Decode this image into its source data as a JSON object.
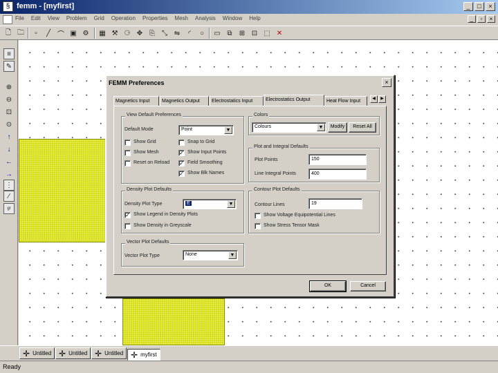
{
  "window": {
    "title": "femm - [myfirst]",
    "icon_glyph": "§"
  },
  "menu": [
    "File",
    "Edit",
    "View",
    "Problem",
    "Grid",
    "Operation",
    "Properties",
    "Mesh",
    "Analysis",
    "Window",
    "Help"
  ],
  "toolbar_icons": [
    {
      "name": "new-file-icon",
      "glyph": "🗋"
    },
    {
      "name": "open-folder-icon",
      "glyph": "🗀"
    },
    {
      "name": "node-mode-icon",
      "glyph": "▫"
    },
    {
      "name": "segment-mode-icon",
      "glyph": "╱"
    },
    {
      "name": "arc-mode-icon",
      "glyph": "⌒"
    },
    {
      "name": "block-label-mode-icon",
      "glyph": "▣"
    },
    {
      "name": "group-mode-icon",
      "glyph": "⚙"
    },
    {
      "name": "mesh-icon",
      "glyph": "▦"
    },
    {
      "name": "run-analysis-icon",
      "glyph": "⚒"
    },
    {
      "name": "view-results-icon",
      "glyph": "⚆"
    },
    {
      "name": "move-icon",
      "glyph": "✥"
    },
    {
      "name": "copy-icon",
      "glyph": "⎘"
    },
    {
      "name": "scale-icon",
      "glyph": "⤡"
    },
    {
      "name": "mirror-icon",
      "glyph": "⇋"
    },
    {
      "name": "fillet-icon",
      "glyph": "◜"
    },
    {
      "name": "circle-icon",
      "glyph": "○"
    },
    {
      "name": "window-icon",
      "glyph": "▭"
    },
    {
      "name": "cascade-icon",
      "glyph": "⧉"
    },
    {
      "name": "tile-icon",
      "glyph": "⊞"
    },
    {
      "name": "snap-icon",
      "glyph": "⊡"
    },
    {
      "name": "select-icon",
      "glyph": "⬚"
    },
    {
      "name": "delete-icon",
      "glyph": "✕"
    }
  ],
  "left_toolbar_icons": [
    {
      "name": "show-mesh-icon",
      "glyph": "≡"
    },
    {
      "name": "edit-icon",
      "glyph": "✎"
    },
    {
      "name": "zoom-in-icon",
      "glyph": "⊕"
    },
    {
      "name": "zoom-out-icon",
      "glyph": "⊖"
    },
    {
      "name": "zoom-window-icon",
      "glyph": "⊡"
    },
    {
      "name": "zoom-natural-icon",
      "glyph": "⊙"
    },
    {
      "name": "pan-up-icon",
      "glyph": "↑"
    },
    {
      "name": "pan-down-icon",
      "glyph": "↓"
    },
    {
      "name": "pan-left-icon",
      "glyph": "←"
    },
    {
      "name": "pan-right-icon",
      "glyph": "→"
    },
    {
      "name": "grid-toggle-icon",
      "glyph": "⋮"
    },
    {
      "name": "snap-grid-icon",
      "glyph": "⁄"
    },
    {
      "name": "grid-size-icon",
      "glyph": "gr"
    }
  ],
  "doc_tabs": [
    "Untitled",
    "Untitled",
    "Untitled",
    "myfirst"
  ],
  "status": "Ready",
  "dialog": {
    "title": "FEMM Preferences",
    "close": "×",
    "tabs": [
      "Magnetics Input",
      "Magnetics Output",
      "Electrostatics Input",
      "Electrostatics Output",
      "Heat Flow Input"
    ],
    "view_defaults": {
      "title": "View Default Preferences",
      "default_mode_label": "Default Mode",
      "default_mode_value": "Point",
      "checkboxes": [
        {
          "label": "Show Grid",
          "checked": false
        },
        {
          "label": "Snap to Grid",
          "checked": false
        },
        {
          "label": "Show Mesh",
          "checked": false
        },
        {
          "label": "Show Input Points",
          "checked": true
        },
        {
          "label": "Reset on Reload",
          "checked": false
        },
        {
          "label": "Field Smoothing",
          "checked": true
        },
        {
          "label": "Show Blk Names",
          "checked": true
        }
      ]
    },
    "colors": {
      "title": "Colors",
      "value": "Colours",
      "modify": "Modify",
      "reset": "Reset All"
    },
    "plot_defaults": {
      "title": "Plot and Integral Defaults",
      "plot_points_label": "Plot Points",
      "plot_points_value": "150",
      "line_integral_label": "Line Integral Points",
      "line_integral_value": "400"
    },
    "density_defaults": {
      "title": "Density Plot Defaults",
      "type_label": "Density Plot Type",
      "type_value": "E",
      "show_legend_label": "Show Legend in Density Plots",
      "show_legend_checked": true,
      "greyscale_label": "Show Density in Greyscale",
      "greyscale_checked": false
    },
    "contour_defaults": {
      "title": "Contour Plot Defaults",
      "lines_label": "Contour Lines",
      "lines_value": "19",
      "voltage_label": "Show Voltage Equipotential Lines",
      "voltage_checked": false,
      "stress_label": "Show Stress Tensor Mask",
      "stress_checked": false
    },
    "vector_defaults": {
      "title": "Vector Plot Defaults",
      "type_label": "Vector Plot Type",
      "type_value": "None"
    },
    "ok": "OK",
    "cancel": "Cancel"
  },
  "colors": {
    "titlebar": "#0a246a",
    "block_fill": "#d6df1a",
    "face": "#d4d0c8"
  }
}
